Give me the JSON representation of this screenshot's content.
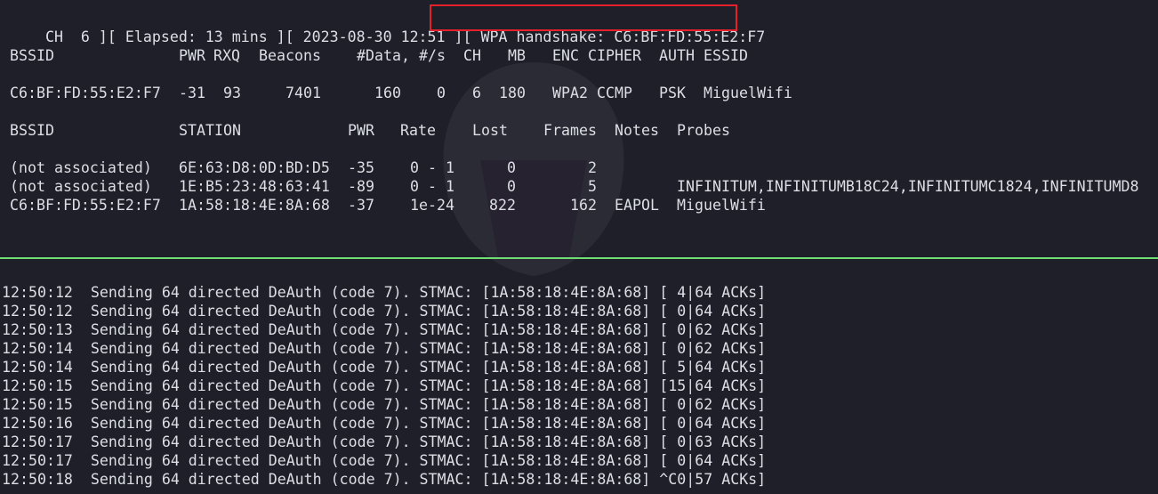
{
  "status": {
    "channel": "CH  6 ][ Elapsed: 13 mins ][ 2023-08-30 12:51 ]",
    "handshake": "[ WPA handshake: C6:BF:FD:55:E2:F7",
    "highlight_color": "#e5222b"
  },
  "ap_table": {
    "headers": [
      "BSSID",
      "PWR",
      "RXQ",
      "Beacons",
      "#Data,",
      "#/s",
      "CH",
      "MB",
      "ENC",
      "CIPHER",
      "AUTH",
      "ESSID"
    ],
    "rows": [
      [
        "C6:BF:FD:55:E2:F7",
        "-31",
        "93",
        "7401",
        "160",
        "0",
        "6",
        "180",
        "WPA2",
        "CCMP",
        "PSK",
        "MiguelWifi"
      ]
    ]
  },
  "station_table": {
    "headers": [
      "BSSID",
      "STATION",
      "PWR",
      "Rate",
      "Lost",
      "Frames",
      "Notes",
      "Probes"
    ],
    "rows": [
      [
        "(not associated)",
        "6E:63:D8:0D:BD:D5",
        "-35",
        "0 - 1",
        "0",
        "2",
        "",
        ""
      ],
      [
        "(not associated)",
        "1E:B5:23:48:63:41",
        "-89",
        "0 - 1",
        "0",
        "5",
        "",
        "INFINITUM,INFINITUMB18C24,INFINITUMC1824,INFINITUMD8"
      ],
      [
        "C6:BF:FD:55:E2:F7",
        "1A:58:18:4E:8A:68",
        "-37",
        "1e-24",
        "822",
        "162",
        "EAPOL",
        "MiguelWifi"
      ]
    ]
  },
  "deauth_log": [
    "12:50:12  Sending 64 directed DeAuth (code 7). STMAC: [1A:58:18:4E:8A:68] [ 4|64 ACKs]",
    "12:50:12  Sending 64 directed DeAuth (code 7). STMAC: [1A:58:18:4E:8A:68] [ 0|64 ACKs]",
    "12:50:13  Sending 64 directed DeAuth (code 7). STMAC: [1A:58:18:4E:8A:68] [ 0|62 ACKs]",
    "12:50:14  Sending 64 directed DeAuth (code 7). STMAC: [1A:58:18:4E:8A:68] [ 0|62 ACKs]",
    "12:50:14  Sending 64 directed DeAuth (code 7). STMAC: [1A:58:18:4E:8A:68] [ 5|64 ACKs]",
    "12:50:15  Sending 64 directed DeAuth (code 7). STMAC: [1A:58:18:4E:8A:68] [15|64 ACKs]",
    "12:50:15  Sending 64 directed DeAuth (code 7). STMAC: [1A:58:18:4E:8A:68] [ 0|62 ACKs]",
    "12:50:16  Sending 64 directed DeAuth (code 7). STMAC: [1A:58:18:4E:8A:68] [ 0|64 ACKs]",
    "12:50:17  Sending 64 directed DeAuth (code 7). STMAC: [1A:58:18:4E:8A:68] [ 0|63 ACKs]",
    "12:50:17  Sending 64 directed DeAuth (code 7). STMAC: [1A:58:18:4E:8A:68] [ 0|64 ACKs]",
    "12:50:18  Sending 64 directed DeAuth (code 7). STMAC: [1A:58:18:4E:8A:68] ^C0|57 ACKs]"
  ],
  "colors": {
    "background": "#1e1f29",
    "text": "#dcdfe4",
    "divider": "#6fdc74"
  }
}
